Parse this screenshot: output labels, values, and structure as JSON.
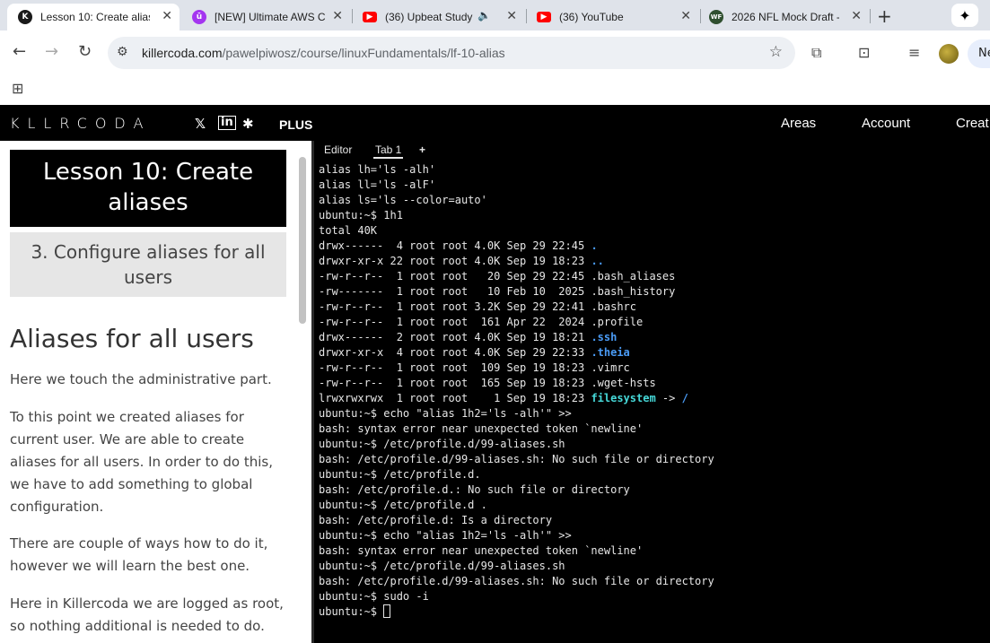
{
  "browser": {
    "tabs": [
      {
        "title": "Lesson 10: Create alias",
        "favicon": "killercoda-icon",
        "active": true
      },
      {
        "title": "[NEW] Ultimate AWS C",
        "favicon": "udemy-icon",
        "active": false
      },
      {
        "title": "(36) Upbeat Study",
        "favicon": "youtube-icon",
        "active": false,
        "audio": true
      },
      {
        "title": "(36) YouTube",
        "favicon": "youtube-icon",
        "active": false
      },
      {
        "title": "2026 NFL Mock Draft -",
        "favicon": "wf-icon",
        "active": false
      }
    ],
    "new_tab": "+",
    "url_host": "killercoda.com",
    "url_path": "/pawelpiwosz/course/linuxFundamentals/lf-10-alias",
    "profile_button": "Ne"
  },
  "header": {
    "logo": "KLLRCODA",
    "plus": "PLUS",
    "nav": [
      "Areas",
      "Account",
      "Creat"
    ]
  },
  "lesson": {
    "title": "Lesson 10: Create aliases",
    "step": "3. Configure aliases for all users",
    "heading": "Aliases for all users",
    "paragraphs": [
      "Here we touch the administrative part.",
      "To this point we created aliases for current user. We are able to create aliases for all users. In order to do this, we have to add something to global configuration.",
      "There are couple of ways how to do it, however we will learn the best one.",
      "Here in Killercoda we are logged as root, so nothing additional is needed to do."
    ]
  },
  "terminal": {
    "tabs": [
      "Editor",
      "Tab 1",
      "+"
    ],
    "lines": [
      "alias lh='ls -alh'",
      "alias ll='ls -alF'",
      "alias ls='ls --color=auto'",
      "ubuntu:~$ 1h1",
      "total 40K"
    ],
    "listing": [
      {
        "perm": "drwx------",
        "n": " 4",
        "size": "4.0K",
        "date": "Sep 29 22:45",
        "name": ".",
        "type": "dir"
      },
      {
        "perm": "drwxr-xr-x",
        "n": "22",
        "size": "4.0K",
        "date": "Sep 19 18:23",
        "name": "..",
        "type": "dir"
      },
      {
        "perm": "-rw-r--r--",
        "n": " 1",
        "size": "  20",
        "date": "Sep 29 22:45",
        "name": ".bash_aliases",
        "type": "file"
      },
      {
        "perm": "-rw-------",
        "n": " 1",
        "size": "  10",
        "date": "Feb 10  2025",
        "name": ".bash_history",
        "type": "file"
      },
      {
        "perm": "-rw-r--r--",
        "n": " 1",
        "size": "3.2K",
        "date": "Sep 29 22:41",
        "name": ".bashrc",
        "type": "file"
      },
      {
        "perm": "-rw-r--r--",
        "n": " 1",
        "size": " 161",
        "date": "Apr 22  2024",
        "name": ".profile",
        "type": "file"
      },
      {
        "perm": "drwx------",
        "n": " 2",
        "size": "4.0K",
        "date": "Sep 19 18:21",
        "name": ".ssh",
        "type": "dir"
      },
      {
        "perm": "drwxr-xr-x",
        "n": " 4",
        "size": "4.0K",
        "date": "Sep 29 22:33",
        "name": ".theia",
        "type": "dir"
      },
      {
        "perm": "-rw-r--r--",
        "n": " 1",
        "size": " 109",
        "date": "Sep 19 18:23",
        "name": ".vimrc",
        "type": "file"
      },
      {
        "perm": "-rw-r--r--",
        "n": " 1",
        "size": " 165",
        "date": "Sep 19 18:23",
        "name": ".wget-hsts",
        "type": "file"
      },
      {
        "perm": "lrwxrwxrwx",
        "n": " 1",
        "size": "   1",
        "date": "Sep 19 18:23",
        "name": "filesystem",
        "type": "link",
        "target": "/"
      }
    ],
    "after": [
      "ubuntu:~$ echo \"alias 1h2='ls -alh'\" >>",
      "bash: syntax error near unexpected token `newline'",
      "ubuntu:~$ /etc/profile.d/99-aliases.sh",
      "bash: /etc/profile.d/99-aliases.sh: No such file or directory",
      "ubuntu:~$ /etc/profile.d.",
      "bash: /etc/profile.d.: No such file or directory",
      "ubuntu:~$ /etc/profile.d .",
      "bash: /etc/profile.d: Is a directory",
      "ubuntu:~$ echo \"alias 1h2='ls -alh'\" >>",
      "bash: syntax error near unexpected token `newline'",
      "ubuntu:~$ /etc/profile.d/99-aliases.sh",
      "bash: /etc/profile.d/99-aliases.sh: No such file or directory",
      "ubuntu:~$ sudo -i"
    ],
    "prompt": "ubuntu:~$ "
  }
}
